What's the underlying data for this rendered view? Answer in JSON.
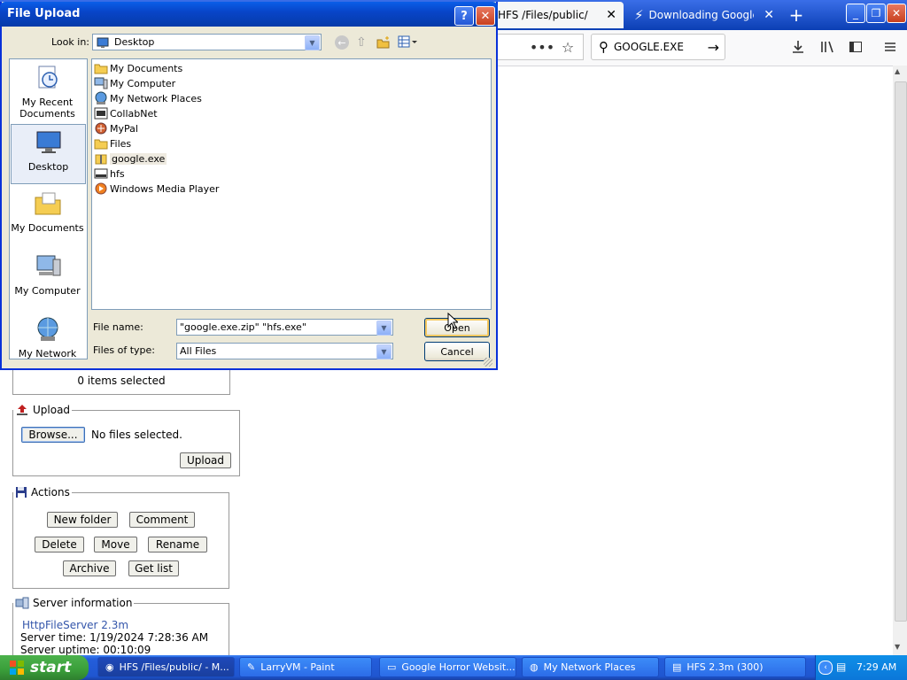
{
  "browser": {
    "tabs": [
      {
        "label": "HFS /Files/public/",
        "close": "✕"
      },
      {
        "label": "Downloading Google.ex",
        "close": "✕"
      }
    ],
    "new_tab": "+",
    "window_buttons": [
      "_",
      "❐",
      "✕"
    ],
    "search_value": "GOOGLE.EXE",
    "icons": [
      "more-icon",
      "bookmark-star-icon",
      "search-icon",
      "go-arrow-icon",
      "download-icon",
      "library-icon",
      "sidebar-icon",
      "menu-icon"
    ]
  },
  "page": {
    "selection": {
      "text": "0 items selected"
    },
    "upload": {
      "legend": "Upload",
      "browse_label": "Browse...",
      "status": "No files selected.",
      "submit_label": "Upload"
    },
    "actions": {
      "legend": "Actions",
      "buttons": [
        "New folder",
        "Comment",
        "Delete",
        "Move",
        "Rename",
        "Archive",
        "Get list"
      ]
    },
    "server_info": {
      "legend": "Server information",
      "link": "HttpFileServer 2.3m",
      "time": "Server time: 1/19/2024 7:28:36 AM",
      "uptime": "Server uptime: 00:10:09"
    }
  },
  "dialog": {
    "title": "File Upload",
    "help": "?",
    "close": "✕",
    "look_in_label": "Look in:",
    "look_in_value": "Desktop",
    "places": [
      "My Recent Documents",
      "Desktop",
      "My Documents",
      "My Computer",
      "My Network"
    ],
    "files": [
      "My Documents",
      "My Computer",
      "My Network Places",
      "CollabNet",
      "MyPal",
      "Files",
      "google.exe",
      "hfs",
      "Windows Media Player"
    ],
    "file_name_label": "File name:",
    "file_name_value": "\"google.exe.zip\" \"hfs.exe\"",
    "file_type_label": "Files of type:",
    "file_type_value": "All Files",
    "open_label": "Open",
    "cancel_label": "Cancel"
  },
  "taskbar": {
    "start_label": "start",
    "tasks": [
      "HFS /Files/public/ - M...",
      "LarryVM - Paint",
      "Google Horror Websit...",
      "My Network Places",
      "HFS 2.3m (300)"
    ],
    "clock": "7:29 AM"
  },
  "colors": {
    "xp_blue": "#0831d9",
    "dialog_bg": "#ece9d8",
    "link": "#3355aa",
    "start_green": "#3a9e3a"
  }
}
